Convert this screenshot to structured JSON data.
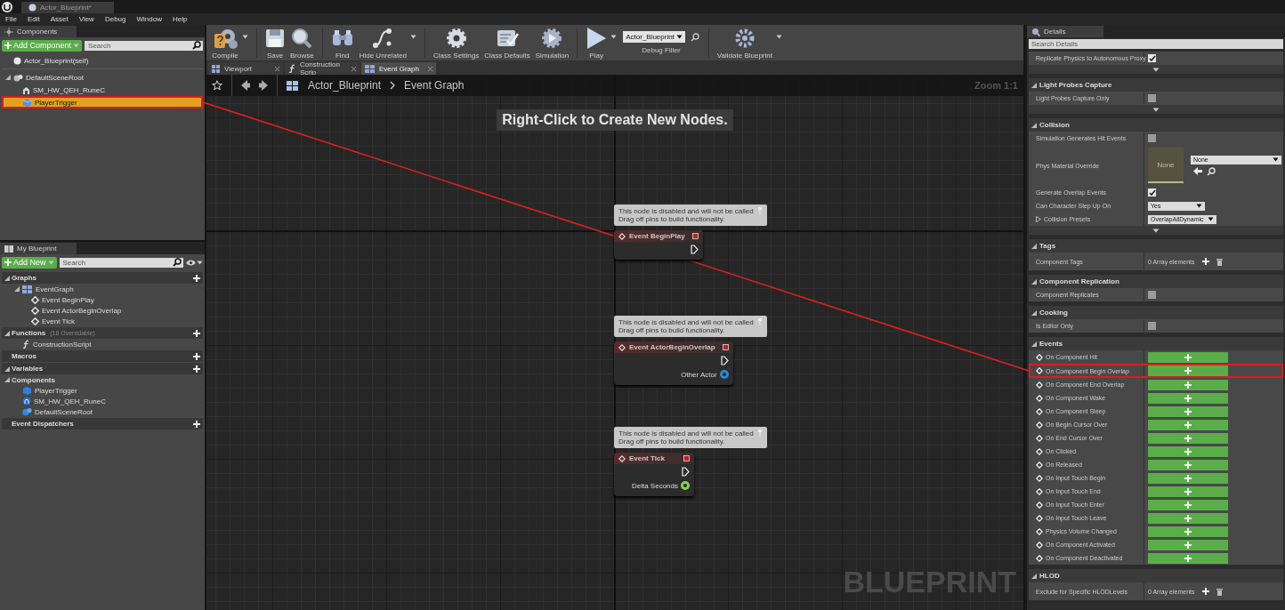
{
  "app": {
    "tab_title": "Actor_Blueprint*"
  },
  "menu": [
    "File",
    "Edit",
    "Asset",
    "View",
    "Debug",
    "Window",
    "Help"
  ],
  "components_panel": {
    "tab": "Components",
    "add_button": "Add Component",
    "search": {
      "placeholder": "Search"
    },
    "tree": [
      {
        "label": "Actor_Blueprint(self)",
        "kind": "actor",
        "selected": false,
        "highlighted": false
      },
      {
        "label": "DefaultSceneRoot",
        "kind": "scene",
        "expanded": true,
        "selected": false,
        "highlighted": false,
        "children": [
          {
            "label": "SM_HW_QEH_RuneC",
            "kind": "mesh",
            "selected": false,
            "highlighted": false
          },
          {
            "label": "PlayerTrigger",
            "kind": "trigger",
            "selected": true,
            "highlighted": true
          }
        ]
      }
    ]
  },
  "my_blueprint": {
    "tab": "My Blueprint",
    "add_button": "Add New",
    "search": {
      "placeholder": "Search"
    },
    "sections": [
      {
        "title": "Graphs",
        "expanded": true,
        "add": true,
        "items": [
          {
            "label": "EventGraph",
            "kind": "graph",
            "children": [
              {
                "label": "Event BeginPlay",
                "kind": "event"
              },
              {
                "label": "Event ActorBeginOverlap",
                "kind": "event"
              },
              {
                "label": "Event Tick",
                "kind": "event"
              }
            ]
          }
        ]
      },
      {
        "title": "Functions",
        "note": "(18 Overridable)",
        "expanded": true,
        "add": true,
        "items": [
          {
            "label": "ConstructionScript",
            "kind": "function"
          }
        ]
      },
      {
        "title": "Macros",
        "expanded": false,
        "add": true
      },
      {
        "title": "Variables",
        "expanded": true,
        "add": true,
        "items": [
          {
            "kind": "category",
            "label": "Components",
            "expanded": true,
            "children": [
              {
                "label": "PlayerTrigger",
                "kind": "trigger_var"
              },
              {
                "label": "SM_HW_QEH_RuneC",
                "kind": "mesh_var"
              },
              {
                "label": "DefaultSceneRoot",
                "kind": "scene_var"
              }
            ]
          }
        ]
      },
      {
        "title": "Event Dispatchers",
        "expanded": false,
        "add": true
      }
    ]
  },
  "toolbar": [
    {
      "kind": "button",
      "label": "Compile",
      "menu": true
    },
    {
      "kind": "separator"
    },
    {
      "kind": "button",
      "label": "Save",
      "menu": false
    },
    {
      "kind": "button",
      "label": "Browse",
      "menu": false
    },
    {
      "kind": "separator"
    },
    {
      "kind": "button",
      "label": "Find",
      "menu": false
    },
    {
      "kind": "button",
      "label": "Hide Unrelated",
      "menu": true
    },
    {
      "kind": "separator"
    },
    {
      "kind": "button",
      "label": "Class Settings",
      "menu": false
    },
    {
      "kind": "button",
      "label": "Class Defaults",
      "menu": false
    },
    {
      "kind": "button",
      "label": "Simulation",
      "menu": false
    },
    {
      "kind": "separator"
    },
    {
      "kind": "button",
      "label": "Play",
      "menu": true
    },
    {
      "kind": "filter",
      "value": "Actor_Blueprint",
      "label": "Debug Filter"
    },
    {
      "kind": "separator"
    },
    {
      "kind": "button",
      "label": "Validate Blueprint",
      "menu": true
    }
  ],
  "doc_tabs": [
    {
      "label": "Viewport",
      "selected": false
    },
    {
      "label": "Construction Scrip",
      "selected": false
    },
    {
      "label": "Event Graph",
      "selected": true
    }
  ],
  "graph": {
    "breadcrumb": [
      "Actor_Blueprint",
      "Event Graph"
    ],
    "zoom": "Zoom 1:1",
    "hint": "Right-Click to Create New Nodes.",
    "watermark": "BLUEPRINT",
    "nodes": [
      {
        "title": "Event BeginPlay",
        "disabled": true,
        "comment": "This node is disabled and will not be called\nDrag off pins to build functionality.",
        "pins": [
          {
            "kind": "exec"
          }
        ]
      },
      {
        "title": "Event ActorBeginOverlap",
        "disabled": true,
        "comment": "This node is disabled and will not be called\nDrag off pins to build functionality.",
        "pins": [
          {
            "kind": "exec"
          },
          {
            "kind": "data",
            "label": "Other Actor",
            "color": "#2a8ad0"
          }
        ]
      },
      {
        "title": "Event Tick",
        "disabled": true,
        "comment": "This node is disabled and will not be called\nDrag off pins to build functionality.",
        "pins": [
          {
            "kind": "exec"
          },
          {
            "kind": "data",
            "label": "Delta Seconds",
            "color": "#8bd048"
          }
        ]
      }
    ]
  },
  "details": {
    "tab": "Details",
    "search": {
      "placeholder": "Search Details"
    },
    "sections": [
      {
        "rows": [
          {
            "kind": "checkbox",
            "label": "Replicate Physics to Autonomous Proxy",
            "checked": true
          }
        ],
        "advanced": true
      },
      {
        "title": "Light Probes Capture",
        "expanded": true,
        "rows": [
          {
            "kind": "checkbox",
            "label": "Light Probes Capture Only",
            "checked": false
          }
        ],
        "advanced": true
      },
      {
        "title": "Collision",
        "expanded": true,
        "rows": [
          {
            "kind": "checkbox",
            "label": "Simulation Generates Hit Events",
            "checked": false
          },
          {
            "kind": "material",
            "label": "Phys Material Override",
            "thumb": "None",
            "value": "None"
          },
          {
            "kind": "checkbox",
            "label": "Generate Overlap Events",
            "checked": true
          },
          {
            "kind": "dropdown",
            "label": "Can Character Step Up On",
            "value": "Yes"
          },
          {
            "kind": "dropdown",
            "label": "Collision Presets",
            "value": "OverlapAllDynamic",
            "expandable": true
          }
        ],
        "advanced": true
      },
      {
        "title": "Tags",
        "expanded": true,
        "rows": [
          {
            "kind": "array",
            "label": "Component Tags",
            "value": "0 Array elements"
          }
        ]
      },
      {
        "title": "Component Replication",
        "expanded": true,
        "rows": [
          {
            "kind": "checkbox",
            "label": "Component Replicates",
            "checked": false
          }
        ]
      },
      {
        "title": "Cooking",
        "expanded": true,
        "rows": [
          {
            "kind": "checkbox",
            "label": "Is Editor Only",
            "checked": false
          }
        ]
      },
      {
        "title": "Events",
        "expanded": true,
        "rows": [
          {
            "kind": "event",
            "label": "On Component Hit",
            "highlighted": false
          },
          {
            "kind": "event",
            "label": "On Component Begin Overlap",
            "highlighted": true
          },
          {
            "kind": "event",
            "label": "On Component End Overlap",
            "highlighted": false
          },
          {
            "kind": "event",
            "label": "On Component Wake",
            "highlighted": false
          },
          {
            "kind": "event",
            "label": "On Component Sleep",
            "highlighted": false
          },
          {
            "kind": "event",
            "label": "On Begin Cursor Over",
            "highlighted": false
          },
          {
            "kind": "event",
            "label": "On End Cursor Over",
            "highlighted": false
          },
          {
            "kind": "event",
            "label": "On Clicked",
            "highlighted": false
          },
          {
            "kind": "event",
            "label": "On Released",
            "highlighted": false
          },
          {
            "kind": "event",
            "label": "On Input Touch Begin",
            "highlighted": false
          },
          {
            "kind": "event",
            "label": "On Input Touch End",
            "highlighted": false
          },
          {
            "kind": "event",
            "label": "On Input Touch Enter",
            "highlighted": false
          },
          {
            "kind": "event",
            "label": "On Input Touch Leave",
            "highlighted": false
          },
          {
            "kind": "event",
            "label": "Physics Volume Changed",
            "highlighted": false
          },
          {
            "kind": "event",
            "label": "On Component Activated",
            "highlighted": false
          },
          {
            "kind": "event",
            "label": "On Component Deactivated",
            "highlighted": false
          }
        ]
      },
      {
        "title": "HLOD",
        "expanded": true,
        "rows": [
          {
            "kind": "array",
            "label": "Exclude for Specific HLODLevels",
            "value": "0 Array elements"
          }
        ]
      }
    ]
  }
}
